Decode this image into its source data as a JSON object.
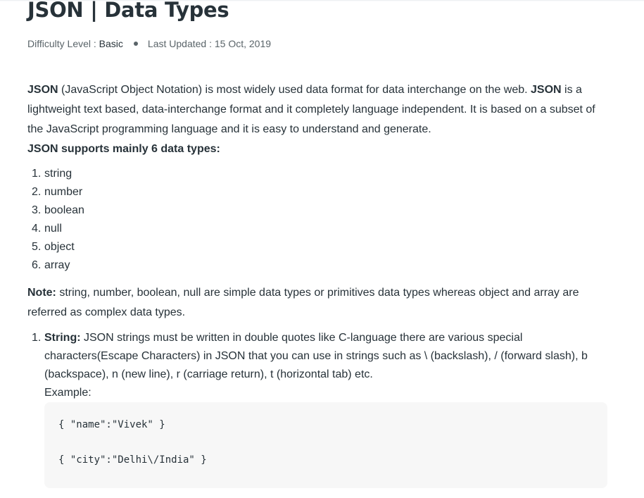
{
  "article": {
    "title": "JSON | Data Types",
    "difficulty_label": "Difficulty Level :",
    "difficulty_value": "Basic",
    "updated_label": "Last Updated :",
    "updated_value": "15 Oct, 2019"
  },
  "intro": {
    "json1": "JSON",
    "text1": " (JavaScript Object Notation) is most widely used data format for data interchange on the web. ",
    "json2": "JSON",
    "text2": " is a lightweight text based, data-interchange format and it completely language independent. It is based on a subset of the JavaScript programming language and it is easy to understand and generate.",
    "supports": "JSON supports mainly 6 data types:"
  },
  "types": [
    {
      "num": "1.",
      "label": "string"
    },
    {
      "num": "2.",
      "label": "number"
    },
    {
      "num": "3.",
      "label": "boolean"
    },
    {
      "num": "4.",
      "label": "null"
    },
    {
      "num": "5.",
      "label": "object"
    },
    {
      "num": "6.",
      "label": "array"
    }
  ],
  "note": {
    "label": "Note:",
    "text": " string, number, boolean, null are simple data types or primitives data types whereas object and array are referred as complex data types."
  },
  "string_section": {
    "num": "1.",
    "label": "String:",
    "text": " JSON strings must be written in double quotes like C-language there are various special characters(Escape Characters) in JSON that you can use in strings such as \\ (backslash), / (forward slash), b (backspace), n (new line), r (carriage return), t (horizontal tab) etc.",
    "example_label": "Example:",
    "code": [
      "{ \"name\":\"Vivek\" }",
      "{ \"city\":\"Delhi\\/India\" }"
    ]
  }
}
